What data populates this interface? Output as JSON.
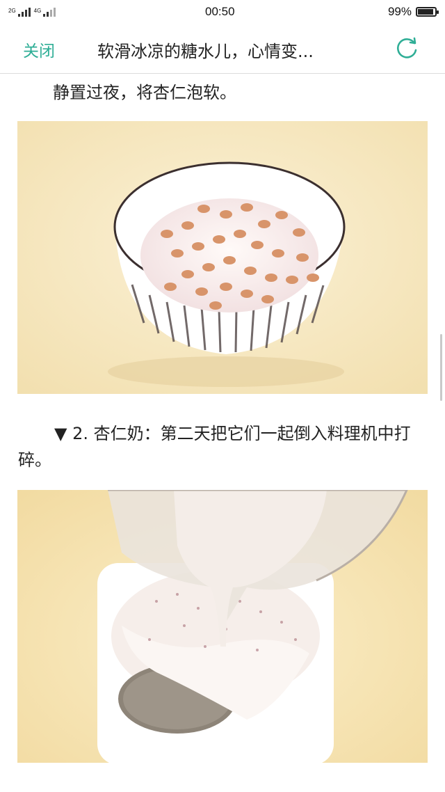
{
  "status_bar": {
    "network_left": "2G",
    "network_right": "4G",
    "time": "00:50",
    "battery_percent": "99%",
    "battery_level": 0.99
  },
  "nav": {
    "close_label": "关闭",
    "title": "软滑冰凉的糖水儿，心情变...",
    "refresh_icon": "refresh-icon",
    "accent_color": "#2fae96"
  },
  "article": {
    "paragraph_1": "静置过夜，将杏仁泡软。",
    "image_1_alt": "bowl-of-soaked-almonds",
    "paragraph_2": "▼ 2. 杏仁奶：第二天把它们一起倒入料理机中打碎。",
    "image_2_alt": "pouring-almond-milk-through-strainer"
  }
}
